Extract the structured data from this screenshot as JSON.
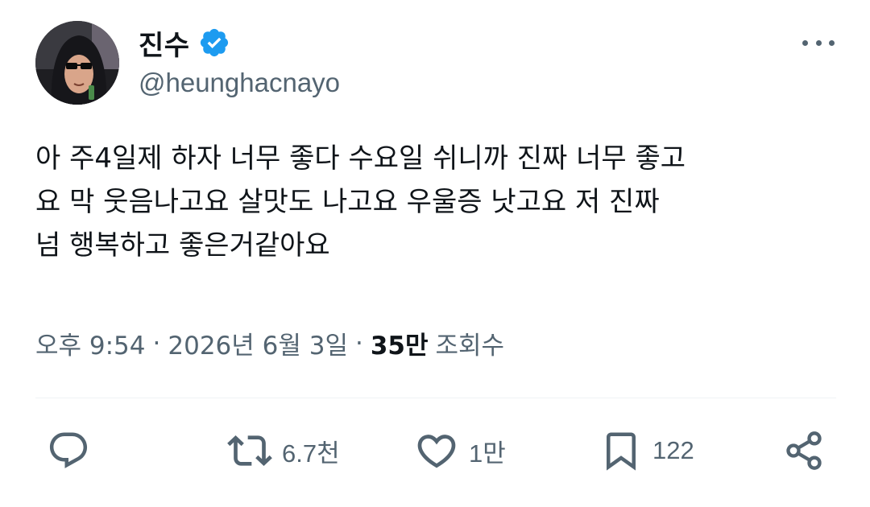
{
  "author": {
    "display_name": "진수",
    "handle": "@heunghacnayo",
    "verified_color": "#1d9bf0"
  },
  "tweet": {
    "text": "아 주4일제 하자 너무 좋다 수요일 쉬니까 진짜 너무 좋고\n요 막 웃음나고요 살맛도 나고요 우울증 낫고요 저 진짜\n넘 행복하고 좋은거같아요"
  },
  "meta": {
    "time": "오후 9:54",
    "separator": "·",
    "date": "2026년 6월 3일",
    "views_count": "35만",
    "views_label": "조회수"
  },
  "actions": {
    "reply": {
      "icon": "reply-icon",
      "count": ""
    },
    "retweet": {
      "icon": "retweet-icon",
      "count": "6.7천"
    },
    "like": {
      "icon": "heart-icon",
      "count": "1만"
    },
    "bookmark": {
      "icon": "bookmark-icon",
      "count": "122"
    },
    "share": {
      "icon": "share-icon",
      "count": ""
    }
  },
  "colors": {
    "text_primary": "#0f1419",
    "text_secondary": "#536471",
    "divider": "#eff3f4",
    "accent": "#1d9bf0"
  }
}
